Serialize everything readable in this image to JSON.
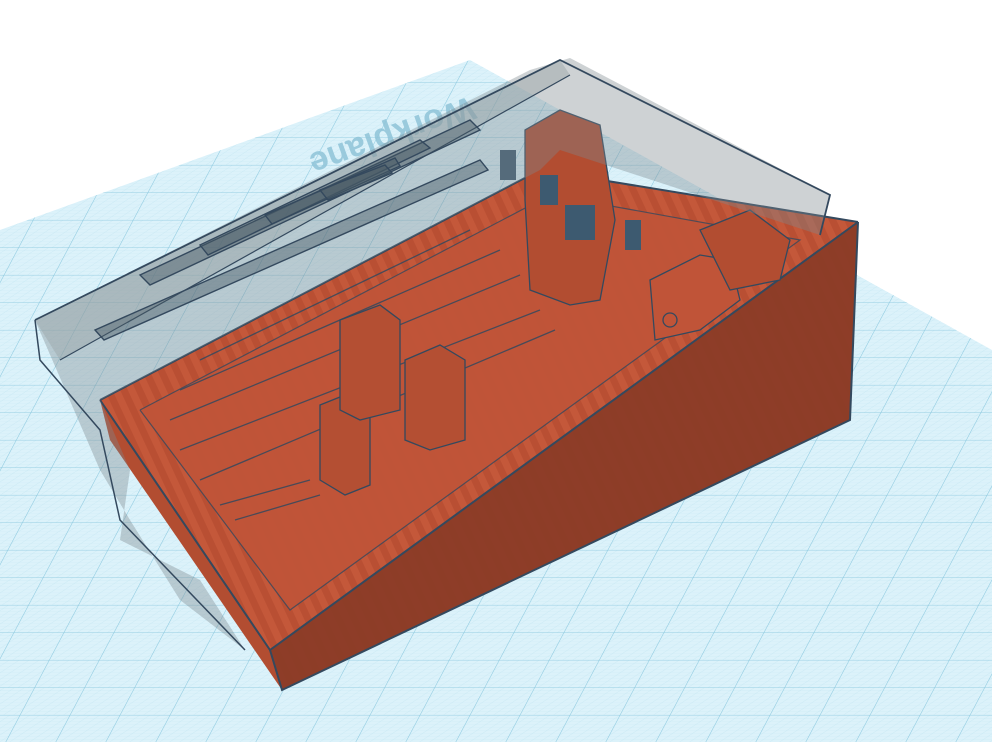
{
  "workplane": {
    "label": "Workplane",
    "grid_color": "#9fd3e6",
    "plane_color": "#d9f1f9"
  },
  "model": {
    "base_color": "#c4583a",
    "base_dark": "#a8462c",
    "shell_color": "#9aa3a6",
    "edge_color": "#34495e",
    "hole_color": "#3d5a70"
  }
}
